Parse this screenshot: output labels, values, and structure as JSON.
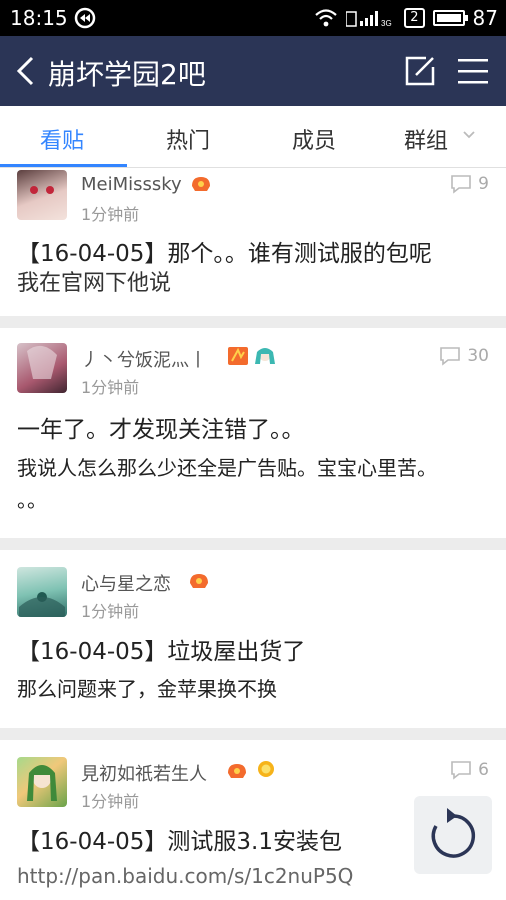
{
  "status_bar": {
    "time": "18:15",
    "sim": "2",
    "battery": "87"
  },
  "nav": {
    "title": "崩坏学园2吧"
  },
  "tabs": [
    {
      "label": "看贴"
    },
    {
      "label": "热门"
    },
    {
      "label": "成员"
    },
    {
      "label": "群组"
    }
  ],
  "posts": [
    {
      "user": "MeiMisssky",
      "time": "1分钟前",
      "comments": "9",
      "title": "【16-04-05】那个。。谁有测试服的包呢",
      "body": "我在官网下他说"
    },
    {
      "user": "丿丶兮饭泥灬丨",
      "time": "1分钟前",
      "comments": "30",
      "title": "一年了。才发现关注错了。。",
      "body": "我说人怎么那么少还全是广告贴。宝宝心里苦。",
      "body2": "。。"
    },
    {
      "user": "心与星之恋",
      "time": "1分钟前",
      "comments": "",
      "title": "【16-04-05】垃圾屋出货了",
      "body": "那么问题来了，金苹果换不换"
    },
    {
      "user": "見初如祇若生人",
      "time": "1分钟前",
      "comments": "6",
      "title": "【16-04-05】测试服3.1安装包",
      "body": "http://pan.baidu.com/s/1c2nuP5Q"
    }
  ]
}
